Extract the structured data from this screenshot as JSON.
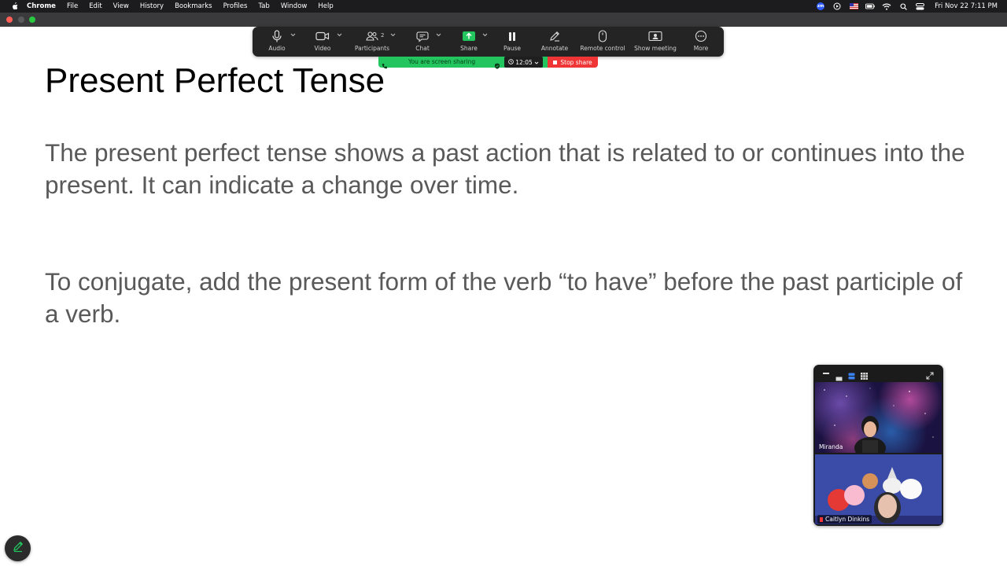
{
  "menubar": {
    "app_name": "Chrome",
    "menus": [
      "File",
      "Edit",
      "View",
      "History",
      "Bookmarks",
      "Profiles",
      "Tab",
      "Window",
      "Help"
    ],
    "status_icons": [
      "zoom-status-icon",
      "play-circle-icon",
      "flag-icon",
      "battery-icon",
      "wifi-icon",
      "search-icon",
      "control-center-icon"
    ],
    "clock": "Fri Nov 22  7:11 PM"
  },
  "zoom_toolbar": {
    "audio_label": "Audio",
    "video_label": "Video",
    "participants_label": "Participants",
    "participants_count": "2",
    "chat_label": "Chat",
    "share_label": "Share",
    "pause_label": "Pause",
    "annotate_label": "Annotate",
    "remote_control_label": "Remote control",
    "show_meeting_label": "Show meeting",
    "more_label": "More"
  },
  "share_status": {
    "message": "You are screen sharing",
    "timer": "12:05",
    "stop_label": "Stop share"
  },
  "colors": {
    "share_green": "#22c55e",
    "stop_red": "#ef3535",
    "toolbar_bg": "#242424",
    "body_text_gray": "#595959"
  },
  "slide": {
    "title": "Present Perfect Tense",
    "paragraph_1": "The present perfect tense shows a past action that is related to or continues into the present. It can indicate a change over time.",
    "paragraph_2": "To conjugate, add the present form of the verb “to have” before the past participle of a verb."
  },
  "video_panel": {
    "participant_1": "Miranda",
    "participant_2": "Caitlyn Dinkins"
  }
}
